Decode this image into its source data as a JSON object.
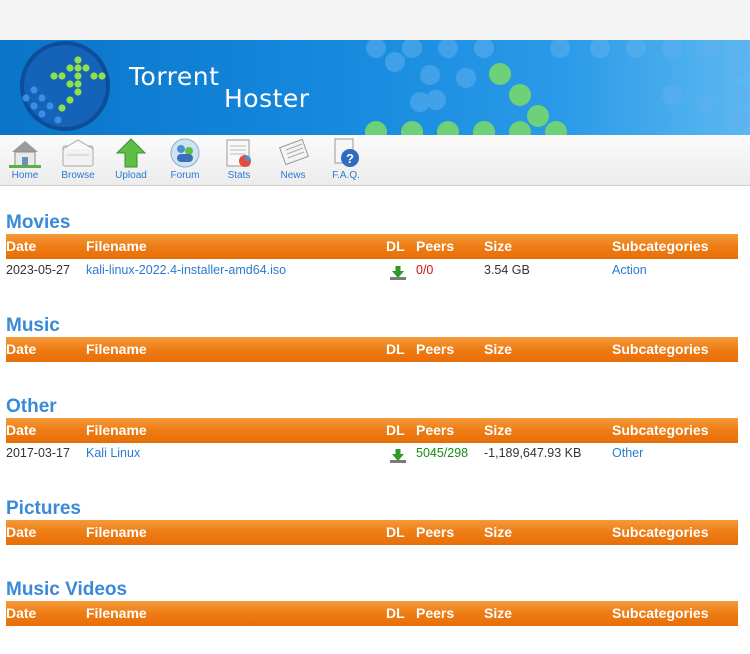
{
  "banner": {
    "title_line1": "Torrent",
    "title_line2": "Hoster"
  },
  "nav": [
    {
      "label": "Home",
      "icon": "home-icon"
    },
    {
      "label": "Browse",
      "icon": "browse-icon"
    },
    {
      "label": "Upload",
      "icon": "upload-icon"
    },
    {
      "label": "Forum",
      "icon": "forum-icon"
    },
    {
      "label": "Stats",
      "icon": "stats-icon"
    },
    {
      "label": "News",
      "icon": "news-icon"
    },
    {
      "label": "F.A.Q.",
      "icon": "faq-icon"
    }
  ],
  "columns": {
    "date": "Date",
    "filename": "Filename",
    "dl": "DL",
    "peers": "Peers",
    "size": "Size",
    "subcategories": "Subcategories"
  },
  "sections": [
    {
      "title": "Movies",
      "rows": [
        {
          "date": "2023-05-27",
          "filename": "kali-linux-2022.4-installer-amd64.iso",
          "peers": "0/0",
          "size": "3.54 GB",
          "subcategory": "Action"
        }
      ]
    },
    {
      "title": "Music",
      "rows": []
    },
    {
      "title": "Other",
      "rows": [
        {
          "date": "2017-03-17",
          "filename": "Kali Linux",
          "peers": "5045/298",
          "size": "-1,189,647.93 KB",
          "subcategory": "Other"
        }
      ]
    },
    {
      "title": "Pictures",
      "rows": []
    },
    {
      "title": "Music Videos",
      "rows": []
    }
  ],
  "colors": {
    "header_orange": "#ee7c14",
    "link_blue": "#2a7bd0",
    "title_blue": "#3a8ad8",
    "peers_zero": "#d01010",
    "peers_active": "#1a8a1a"
  }
}
